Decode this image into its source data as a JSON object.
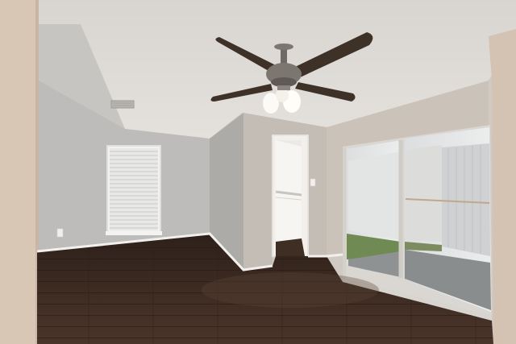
{
  "scene": {
    "kind": "photo",
    "subject": "empty-room-interior",
    "colors": {
      "ceiling": "#dddad6",
      "wall_left": "#bdbcba",
      "wall_back": "#c2c0bd",
      "wall_right": "#cbc3b9",
      "floor": "#3a2a22",
      "baseboard": "#f2f0ec",
      "fan_blade": "#3e3128",
      "fan_metal": "#7b7670",
      "glass": "#e7e8e8",
      "grass": "#6f8b53",
      "patio": "#8f9293"
    }
  }
}
